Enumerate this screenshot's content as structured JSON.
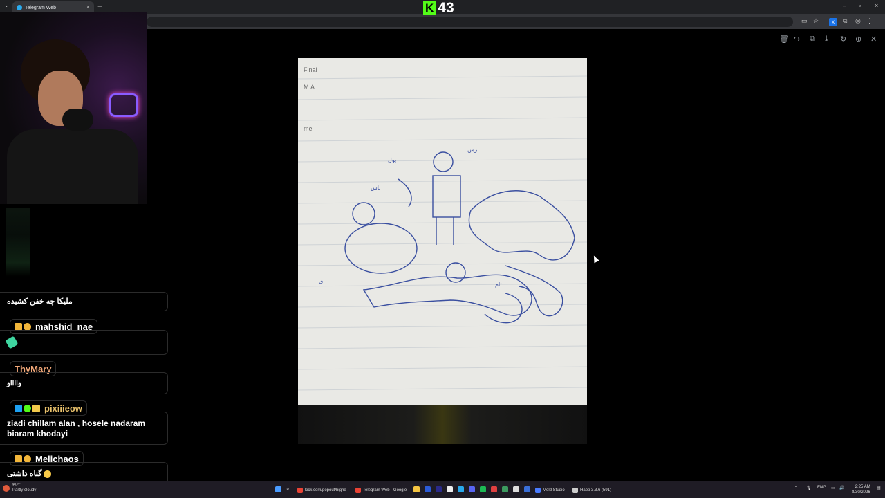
{
  "browser": {
    "tab_title": "Telegram Web",
    "tab_close": "×",
    "new_tab": "+",
    "tab_menu": "⌄",
    "window_controls": [
      "–",
      "▫",
      "×"
    ]
  },
  "kick_overlay": {
    "logo": "K",
    "viewer_count": "43"
  },
  "viewer_tools": [
    "trash-icon",
    "forward-icon",
    "copy-icon",
    "download-icon",
    "rotate-icon",
    "zoom-in-icon",
    "close-icon"
  ],
  "chat": {
    "messages": [
      {
        "text": "ملیکا چه خفن کشیده"
      },
      {
        "username": "mahshid_nae",
        "username_color": "#ffffff",
        "badges": [
          "sub",
          "tier-1"
        ],
        "emote": "feather-emote"
      },
      {
        "username": "ThyMary",
        "username_color": "#f4a979",
        "text": "وااااو"
      },
      {
        "username": "pixiiieow",
        "username_color": "#e7c06b",
        "badges": [
          "vip",
          "verified",
          "crown"
        ],
        "text_lines": [
          "ziadi chillam alan , hosele nadaram",
          "biaram khodayi"
        ]
      },
      {
        "username": "Melichaos",
        "username_color": "#ffffff",
        "badges": [
          "sub",
          "tier-1"
        ],
        "text": "گناه داشتی",
        "emoji": "smile-emoji"
      }
    ]
  },
  "taskbar": {
    "weather_temp": "۳۱°C",
    "weather_desc": "Partly cloudy",
    "items": [
      {
        "label": "kick.com/popout/bighe",
        "color": "#ea4335"
      },
      {
        "label": "Telegram Web - Google",
        "color": "#ea4335"
      },
      {
        "label": "Meld Studio",
        "color": "#4a7cff"
      },
      {
        "label": "Happ 3.3.6 (591)",
        "color": "#cccccc"
      }
    ],
    "lang": "ENG",
    "time": "2:25 AM",
    "date": "8/30/2026"
  }
}
